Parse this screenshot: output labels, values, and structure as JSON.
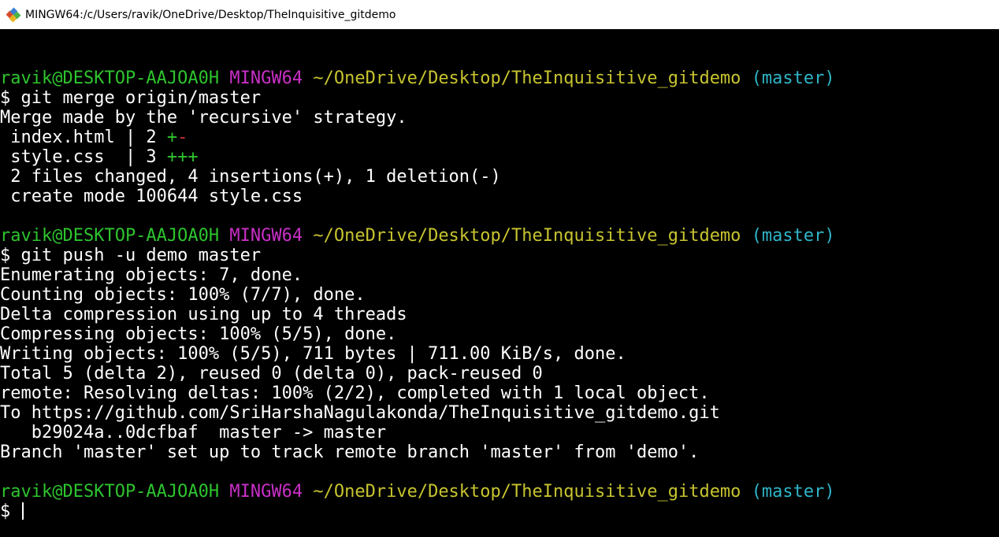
{
  "window": {
    "title": "MINGW64:/c/Users/ravik/OneDrive/Desktop/TheInquisitive_gitdemo",
    "icon": "git-bash-icon"
  },
  "colors": {
    "background": "#000000",
    "text": "#ffffff",
    "user": "#2ec42e",
    "mingw": "#c930c7",
    "path": "#c7c42f",
    "branch": "#2fb5c7",
    "plus": "#2ec42e",
    "minus": "#d02f2f"
  },
  "terminal": {
    "lines": [
      {
        "type": "blank"
      },
      {
        "type": "prompt",
        "user": "ravik@DESKTOP-AAJOA0H",
        "env": "MINGW64",
        "path": "~/OneDrive/Desktop/TheInquisitive_gitdemo",
        "branch": "(master)"
      },
      {
        "type": "command",
        "text": "$ git merge origin/master"
      },
      {
        "type": "output",
        "text": "Merge made by the 'recursive' strategy."
      },
      {
        "type": "diffstat",
        "text": " index.html | 2 ",
        "plus": "+",
        "minus": "-"
      },
      {
        "type": "diffstat",
        "text": " style.css  | 3 ",
        "plus": "+++",
        "minus": ""
      },
      {
        "type": "output",
        "text": " 2 files changed, 4 insertions(+), 1 deletion(-)"
      },
      {
        "type": "output",
        "text": " create mode 100644 style.css"
      },
      {
        "type": "blank"
      },
      {
        "type": "prompt",
        "user": "ravik@DESKTOP-AAJOA0H",
        "env": "MINGW64",
        "path": "~/OneDrive/Desktop/TheInquisitive_gitdemo",
        "branch": "(master)"
      },
      {
        "type": "command",
        "text": "$ git push -u demo master"
      },
      {
        "type": "output",
        "text": "Enumerating objects: 7, done."
      },
      {
        "type": "output",
        "text": "Counting objects: 100% (7/7), done."
      },
      {
        "type": "output",
        "text": "Delta compression using up to 4 threads"
      },
      {
        "type": "output",
        "text": "Compressing objects: 100% (5/5), done."
      },
      {
        "type": "output",
        "text": "Writing objects: 100% (5/5), 711 bytes | 711.00 KiB/s, done."
      },
      {
        "type": "output",
        "text": "Total 5 (delta 2), reused 0 (delta 0), pack-reused 0"
      },
      {
        "type": "output",
        "text": "remote: Resolving deltas: 100% (2/2), completed with 1 local object."
      },
      {
        "type": "output",
        "text": "To https://github.com/SriHarshaNagulakonda/TheInquisitive_gitdemo.git"
      },
      {
        "type": "output",
        "text": "   b29024a..0dcfbaf  master -> master"
      },
      {
        "type": "output",
        "text": "Branch 'master' set up to track remote branch 'master' from 'demo'."
      },
      {
        "type": "blank"
      },
      {
        "type": "prompt",
        "user": "ravik@DESKTOP-AAJOA0H",
        "env": "MINGW64",
        "path": "~/OneDrive/Desktop/TheInquisitive_gitdemo",
        "branch": "(master)"
      },
      {
        "type": "input",
        "text": "$ "
      }
    ]
  }
}
